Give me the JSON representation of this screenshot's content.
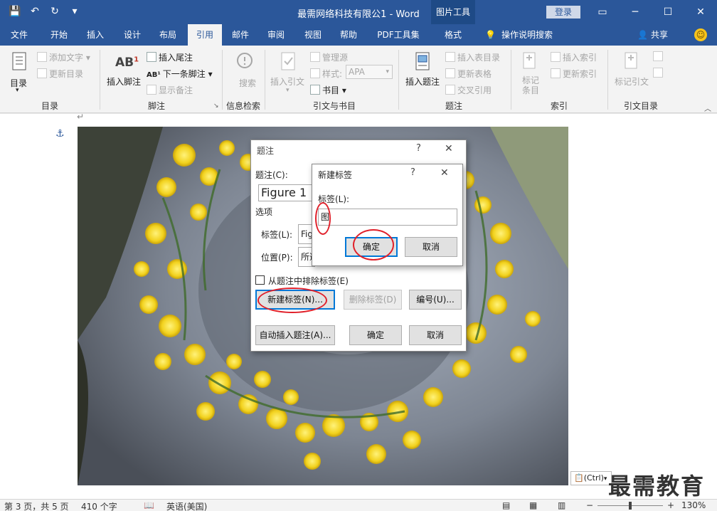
{
  "titlebar": {
    "doc_title": "最需网络科技有限公1 - Word",
    "tools_tab": "图片工具",
    "login": "登录"
  },
  "tabs": [
    {
      "label": "文件"
    },
    {
      "label": "开始"
    },
    {
      "label": "插入"
    },
    {
      "label": "设计"
    },
    {
      "label": "布局"
    },
    {
      "label": "引用"
    },
    {
      "label": "邮件"
    },
    {
      "label": "审阅"
    },
    {
      "label": "视图"
    },
    {
      "label": "帮助"
    },
    {
      "label": "PDF工具集"
    },
    {
      "label": "格式"
    }
  ],
  "tell_me": "操作说明搜索",
  "share": "共享",
  "ribbon": {
    "toc": {
      "button": "目录",
      "add_text": "添加文字",
      "update_toc": "更新目录",
      "label": "目录"
    },
    "footnotes": {
      "insert_footnote": "插入脚注",
      "insert_endnote": "插入尾注",
      "next_footnote": "下一条脚注",
      "show_notes": "显示备注",
      "label": "脚注"
    },
    "research": {
      "search": "搜索",
      "label": "信息检索"
    },
    "citations": {
      "insert_citation": "插入引文",
      "manage_sources": "管理源",
      "style_label": "样式:",
      "style_value": "APA",
      "bibliography": "书目",
      "label": "引文与书目"
    },
    "captions": {
      "insert_caption": "插入题注",
      "insert_table_of_figures": "插入表目录",
      "update_table": "更新表格",
      "cross_reference": "交叉引用",
      "label": "题注"
    },
    "index": {
      "mark_entry": "标记条目",
      "insert_index": "插入索引",
      "update_index": "更新索引",
      "label": "索引"
    },
    "toa": {
      "mark_citation": "标记引文",
      "label": "引文目录"
    }
  },
  "caption_dialog": {
    "title": "题注",
    "caption_label": "题注(C):",
    "caption_value": "Figure 1",
    "options_label": "选项",
    "label_label": "标签(L):",
    "label_value": "Fig",
    "position_label": "位置(P):",
    "position_value": "所选",
    "exclude_label": "从题注中排除标签(E)",
    "new_label_btn": "新建标签(N)...",
    "delete_label_btn": "删除标签(D)",
    "numbering_btn": "编号(U)...",
    "autocaption_btn": "自动插入题注(A)...",
    "ok": "确定",
    "cancel": "取消"
  },
  "new_label_dialog": {
    "title": "新建标签",
    "label_label": "标签(L):",
    "label_value": "图",
    "ok": "确定",
    "cancel": "取消"
  },
  "paste_options": "(Ctrl)",
  "watermark": "最需教育",
  "status": {
    "page": "第 3 页，共 5 页",
    "words": "410 个字",
    "language": "英语(美国)",
    "zoom": "130%"
  }
}
